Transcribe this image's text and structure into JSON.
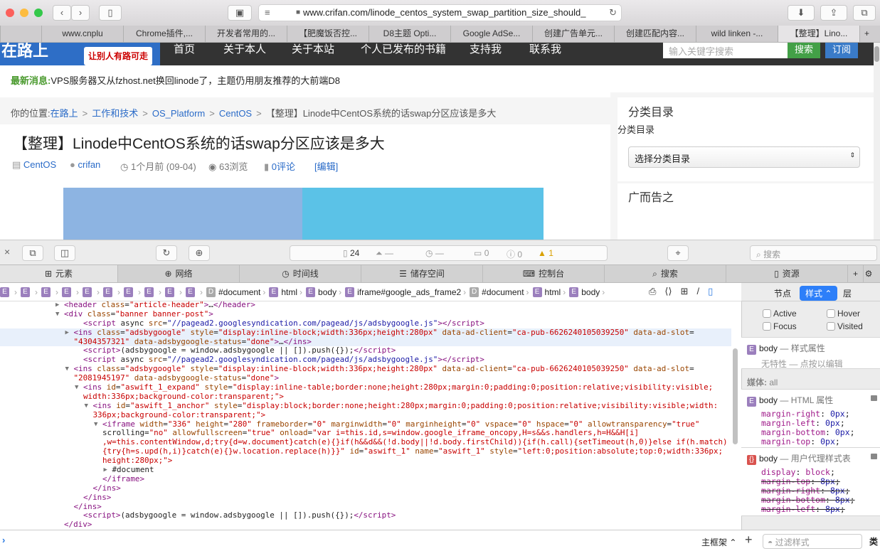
{
  "browser": {
    "url": "www.crifan.com/linode_centos_system_swap_partition_size_should_",
    "tabs": [
      "",
      "www.cnplu",
      "Chrome插件,...",
      "开发者常用的...",
      "【肥魔饭否控...",
      "D8主题 Opti...",
      "Google AdSe...",
      "创建广告单元...",
      "创建匹配内容...",
      "wild linken -...",
      "【整理】Lino..."
    ],
    "new_tab": "+"
  },
  "site": {
    "logo": "在路上",
    "logo_sub": "让别人有路可走",
    "nav": [
      "首页",
      "关于本人",
      "关于本站",
      "个人已发布的书籍",
      "支持我",
      "联系我"
    ],
    "search_placeholder": "输入关键字搜索",
    "search_btn": "搜索",
    "subscribe_btn": "订阅",
    "news_label": "最新消息:",
    "news_text": "VPS服务器又从fzhost.net换回linode了，主题仍用朋友推荐的大前端D8",
    "breadcrumb": {
      "label": "你的位置:",
      "items": [
        "在路上",
        "工作和技术",
        "OS_Platform",
        "CentOS"
      ],
      "current": "【整理】Linode中CentOS系统的话swap分区应该是多大",
      "sep": ">"
    },
    "title": "【整理】Linode中CentOS系统的话swap分区应该是多大",
    "meta": {
      "category": "CentOS",
      "author": "crifan",
      "time": "1个月前 (09-04)",
      "views": "63浏览",
      "comments": "0评论",
      "edit": "[编辑]"
    },
    "sidebar": {
      "cat_heading": "分类目录",
      "cat_label": "分类目录",
      "cat_select": "选择分类目录",
      "ad_heading": "广而告之"
    }
  },
  "devtools": {
    "dash": {
      "resources": "24",
      "size": "—",
      "time": "—",
      "logs": "0",
      "errors": "0",
      "warnings": "1"
    },
    "search_placeholder": "搜索",
    "tabs": [
      "元素",
      "网络",
      "时间线",
      "储存空间",
      "控制台",
      "搜索",
      "资源"
    ],
    "breadcrumb": [
      {
        "t": "E",
        "l": ""
      },
      {
        "t": "E",
        "l": ""
      },
      {
        "t": "E",
        "l": ""
      },
      {
        "t": "E",
        "l": ""
      },
      {
        "t": "E",
        "l": ""
      },
      {
        "t": "E",
        "l": ""
      },
      {
        "t": "E",
        "l": ""
      },
      {
        "t": "E",
        "l": ""
      },
      {
        "t": "E",
        "l": ""
      },
      {
        "t": "E",
        "l": ""
      },
      {
        "t": "D",
        "l": "#document"
      },
      {
        "t": "E",
        "l": "html"
      },
      {
        "t": "E",
        "l": "body"
      },
      {
        "t": "E",
        "l": "iframe#google_ads_frame2"
      },
      {
        "t": "D",
        "l": "#document"
      },
      {
        "t": "E",
        "l": "html"
      },
      {
        "t": "E",
        "l": "body"
      }
    ],
    "code": [
      {
        "i": 5,
        "a": "▶",
        "s": "<header class=\"article-header\">…</header>"
      },
      {
        "i": 5,
        "a": "▼",
        "s": "<div class=\"banner banner-post\">"
      },
      {
        "i": 7,
        "a": "",
        "s": "<script async src=\"//pagead2.googlesyndication.com/pagead/js/adsbygoogle.js\"></script>"
      },
      {
        "i": 6,
        "a": "▶",
        "s": "<ins class=\"adsbygoogle\" style=\"display:inline-block;width:336px;height:280px\" data-ad-client=\"ca-pub-6626240105039250\" data-ad-slot=",
        "sel": true
      },
      {
        "i": 6,
        "a": "",
        "s": "\"4304357321\" data-adsbygoogle-status=\"done\">…</ins>",
        "sel": true
      },
      {
        "i": 7,
        "a": "",
        "s": "<script>(adsbygoogle = window.adsbygoogle || []).push({});</script>"
      },
      {
        "i": 7,
        "a": "",
        "s": "<script async src=\"//pagead2.googlesyndication.com/pagead/js/adsbygoogle.js\"></script>"
      },
      {
        "i": 6,
        "a": "▼",
        "s": "<ins class=\"adsbygoogle\" style=\"display:inline-block;width:336px;height:280px\" data-ad-client=\"ca-pub-6626240105039250\" data-ad-slot="
      },
      {
        "i": 6,
        "a": "",
        "s": "\"2081945197\" data-adsbygoogle-status=\"done\">"
      },
      {
        "i": 7,
        "a": "▼",
        "s": "<ins id=\"aswift_1_expand\" style=\"display:inline-table;border:none;height:280px;margin:0;padding:0;position:relative;visibility:visible;"
      },
      {
        "i": 7,
        "a": "",
        "s": "width:336px;background-color:transparent;\">",
        "cont": true
      },
      {
        "i": 8,
        "a": "▼",
        "s": "<ins id=\"aswift_1_anchor\" style=\"display:block;border:none;height:280px;margin:0;padding:0;position:relative;visibility:visible;width:"
      },
      {
        "i": 8,
        "a": "",
        "s": "336px;background-color:transparent;\">",
        "cont": true
      },
      {
        "i": 9,
        "a": "▼",
        "s": "<iframe width=\"336\" height=\"280\" frameborder=\"0\" marginwidth=\"0\" marginheight=\"0\" vspace=\"0\" hspace=\"0\" allowtransparency=\"true\""
      },
      {
        "i": 9,
        "a": "",
        "s": "scrolling=\"no\" allowfullscreen=\"true\" onload=\"var i=this.id,s=window.google_iframe_oncopy,H=s&&s.handlers,h=H&&H[i]"
      },
      {
        "i": 9,
        "a": "",
        "s": ",w=this.contentWindow,d;try{d=w.document}catch(e){}if(h&&d&&(!d.body||!d.body.firstChild)){if(h.call){setTimeout(h,0)}else if(h.match)",
        "cont": true
      },
      {
        "i": 9,
        "a": "",
        "s": "{try{h=s.upd(h,i)}catch(e){}w.location.replace(h)}}\" id=\"aswift_1\" name=\"aswift_1\" style=\"left:0;position:absolute;top:0;width:336px;",
        "cont2": true
      },
      {
        "i": 9,
        "a": "",
        "s": "height:280px;\">",
        "cont": true
      },
      {
        "i": 10,
        "a": "▶",
        "s": "#document",
        "plain": true
      },
      {
        "i": 9,
        "a": "",
        "s": "</iframe>"
      },
      {
        "i": 8,
        "a": "",
        "s": "</ins>"
      },
      {
        "i": 7,
        "a": "",
        "s": "</ins>"
      },
      {
        "i": 6,
        "a": "",
        "s": "</ins>"
      },
      {
        "i": 7,
        "a": "",
        "s": "<script>(adsbygoogle = window.adsbygoogle || []).push({});</script>"
      },
      {
        "i": 5,
        "a": "",
        "s": "</div>"
      }
    ],
    "side_tabs": {
      "node": "节点",
      "styles": "样式",
      "layers": "层"
    },
    "pseudo": [
      "Active",
      "Hover",
      "Focus",
      "Visited"
    ],
    "rules": {
      "style_attr": {
        "sel": "body",
        "origin": "— 样式属性",
        "note": "无特性 — 点按以编辑"
      },
      "media_label": "媒体:",
      "media": "all",
      "html_attr": {
        "sel": "body",
        "origin": "— HTML 属性",
        "props": [
          [
            "margin-right",
            "0px"
          ],
          [
            "margin-left",
            "0px"
          ],
          [
            "margin-bottom",
            "0px"
          ],
          [
            "margin-top",
            "0px"
          ]
        ]
      },
      "ua": {
        "sel": "body",
        "origin": "— 用户代理样式表",
        "props": [
          [
            "display",
            "block",
            false
          ],
          [
            "margin-top",
            "8px",
            true
          ],
          [
            "margin-right",
            "8px",
            true
          ],
          [
            "margin-bottom",
            "8px",
            true
          ],
          [
            "margin-left",
            "8px",
            true
          ]
        ]
      }
    },
    "console_frame": "主框架 ⌃",
    "filter_placeholder": "过滤样式",
    "class_btn": "类"
  }
}
